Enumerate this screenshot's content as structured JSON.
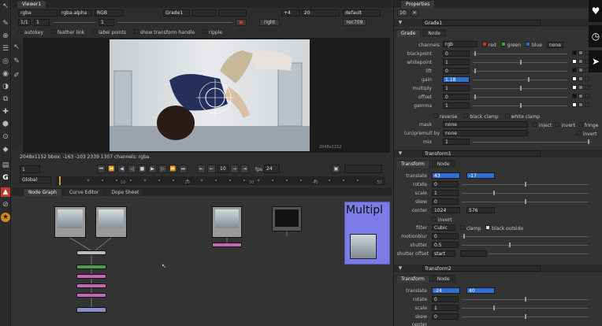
{
  "viewer": {
    "tab": "Viewer1",
    "channels": "rgba",
    "alpha": "rgba.alpha",
    "colorspace": "RGB",
    "input_a": "Grade1",
    "zoom": "+4",
    "gain_val": "20",
    "lut": "default",
    "frame": "1",
    "gamma_val": "1",
    "proxy": "1/1",
    "view": "right",
    "format": "rec709",
    "toggles": [
      "autokey",
      "feather link",
      "label points",
      "show transform handle",
      "ripple"
    ],
    "image_overlay": "2048x1152",
    "status": "2048x1152 bbox: -163 -103 2339 1307 channels: rgba",
    "frame_counter": "1",
    "play_frame": "10",
    "fps_label": "fps",
    "fps": "24",
    "global_dropdown": "Global",
    "timeline_ticks": [
      "1",
      "10",
      "20",
      "30",
      "40",
      "50"
    ]
  },
  "nodegraph": {
    "tabs": [
      "Node Graph",
      "Curve Editor",
      "Dope Sheet"
    ],
    "overlay_text": "Multipl"
  },
  "properties": {
    "tab": "Properties",
    "grade": {
      "name": "Grade1",
      "tabs": [
        "Grade",
        "Node"
      ],
      "channels_label": "channels",
      "channels_value": "rgb",
      "red": "red",
      "green": "green",
      "blue": "blue",
      "none": "none",
      "rows": [
        {
          "label": "blackpoint",
          "value": "0"
        },
        {
          "label": "whitepoint",
          "value": "1"
        },
        {
          "label": "lift",
          "value": "0"
        },
        {
          "label": "gain",
          "value": "1.18"
        },
        {
          "label": "multiply",
          "value": "1"
        },
        {
          "label": "offset",
          "value": "0"
        },
        {
          "label": "gamma",
          "value": "1"
        }
      ],
      "reverse": "reverse",
      "black_clamp": "black clamp",
      "white_clamp": "white clamp",
      "mask_label": "mask",
      "mask_value": "none",
      "inject": "inject",
      "invert": "invert",
      "fringe": "fringe",
      "unpremult_label": "(un)premult by",
      "unpremult_value": "none",
      "invert2": "invert",
      "mix_label": "mix",
      "mix_value": "1"
    },
    "transform1": {
      "name": "Transform1",
      "tabs": [
        "Transform",
        "Node"
      ],
      "translate_label": "translate",
      "tx": "43",
      "ty": "-17",
      "rotate_label": "rotate",
      "rotate": "0",
      "scale_label": "scale",
      "scale": "1",
      "skew_label": "skew",
      "skew": "0",
      "center_label": "center",
      "cx": "1024",
      "cy": "576",
      "invert": "invert",
      "filter_label": "filter",
      "filter": "Cubic",
      "clamp": "clamp",
      "black_outside": "black outside",
      "motionblur_label": "motionblur",
      "motionblur": "0",
      "shutter_label": "shutter",
      "shutter": "0.5",
      "shutter_offset_label": "shutter offset",
      "shutter_offset": "start"
    },
    "transform2": {
      "name": "Transform2",
      "tabs": [
        "Transform",
        "Node"
      ],
      "translate_label": "translate",
      "tx": "-24",
      "ty": "40",
      "rotate_label": "rotate",
      "rotate": "0",
      "scale_label": "scale",
      "scale": "1",
      "skew_label": "skew",
      "skew": "0",
      "center_label": "center"
    }
  },
  "colors": {
    "gain_highlight": "#2f6fd0",
    "node_purple": "#7b7bea",
    "node_green": "#4aa04a",
    "node_pink": "#c266b8",
    "nuke_red": "#c0392b"
  }
}
